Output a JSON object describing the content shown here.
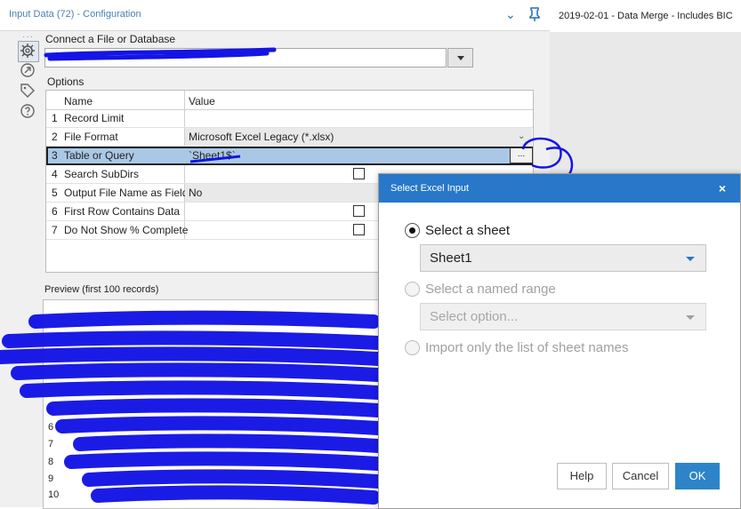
{
  "panel": {
    "title": "Input Data (72) - Configuration",
    "connect_label": "Connect a File or Database",
    "options_label": "Options",
    "preview_label": "Preview (first 100 records)"
  },
  "grid": {
    "headers": {
      "name": "Name",
      "value": "Value"
    },
    "rows": [
      {
        "num": "1",
        "name": "Record Limit",
        "value": ""
      },
      {
        "num": "2",
        "name": "File Format",
        "value": "Microsoft Excel Legacy (*.xlsx)"
      },
      {
        "num": "3",
        "name": "Table or Query",
        "value": "`Sheet1$`",
        "button": "..."
      },
      {
        "num": "4",
        "name": "Search SubDirs",
        "value": ""
      },
      {
        "num": "5",
        "name": "Output File Name as Field",
        "value": "No"
      },
      {
        "num": "6",
        "name": "First Row Contains Data",
        "value": ""
      },
      {
        "num": "7",
        "name": "Do Not Show % Complete",
        "value": ""
      }
    ]
  },
  "preview": {
    "row_numbers": [
      "5",
      "6",
      "7",
      "8",
      "9",
      "10"
    ]
  },
  "right_tab": {
    "title": "2019-02-01 - Data Merge - Includes BIC"
  },
  "dialog": {
    "title": "Select Excel Input",
    "close": "×",
    "option_sheet": "Select a sheet",
    "sheet_value": "Sheet1",
    "option_named_range": "Select a named range",
    "named_range_placeholder": "Select option...",
    "option_sheet_names": "Import only the list of sheet names",
    "buttons": {
      "help": "Help",
      "cancel": "Cancel",
      "ok": "OK"
    }
  },
  "icons": {
    "header": [
      "chevron-down-icon",
      "pin-icon"
    ],
    "rail": [
      "gear-icon",
      "arrow-circle-icon",
      "tag-icon",
      "help-icon"
    ]
  },
  "colors": {
    "accent": "#2877c9",
    "ok_button": "#2e84c8",
    "selected_row": "#aac8e6",
    "scribble": "#1414e6"
  }
}
